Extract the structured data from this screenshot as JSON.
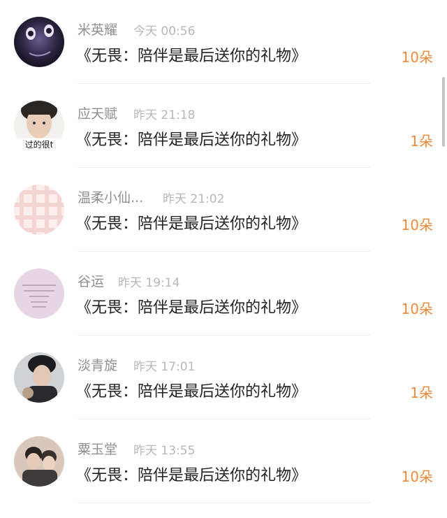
{
  "records": [
    {
      "name": "米英耀",
      "time": "今天 00:56",
      "title": "《无畏：陪伴是最后送你的礼物》",
      "gift": "10朵"
    },
    {
      "name": "应天赋",
      "time": "昨天 21:18",
      "title": "《无畏：陪伴是最后送你的礼物》",
      "gift": "1朵",
      "avatar_text": "过的很t"
    },
    {
      "name": "温柔小仙...",
      "time": "昨天 21:02",
      "title": "《无畏：陪伴是最后送你的礼物》",
      "gift": "10朵"
    },
    {
      "name": "谷运",
      "time": "昨天 19:14",
      "title": "《无畏：陪伴是最后送你的礼物》",
      "gift": "10朵"
    },
    {
      "name": "淡青旋",
      "time": "昨天 17:01",
      "title": "《无畏：陪伴是最后送你的礼物》",
      "gift": "1朵"
    },
    {
      "name": "粟玉堂",
      "time": "昨天 13:55",
      "title": "《无畏：陪伴是最后送你的礼物》",
      "gift": "10朵"
    }
  ],
  "colors": {
    "gift": "#f08a3c",
    "name": "#8f8f8f",
    "time": "#b7b7b7",
    "title": "#222222"
  }
}
